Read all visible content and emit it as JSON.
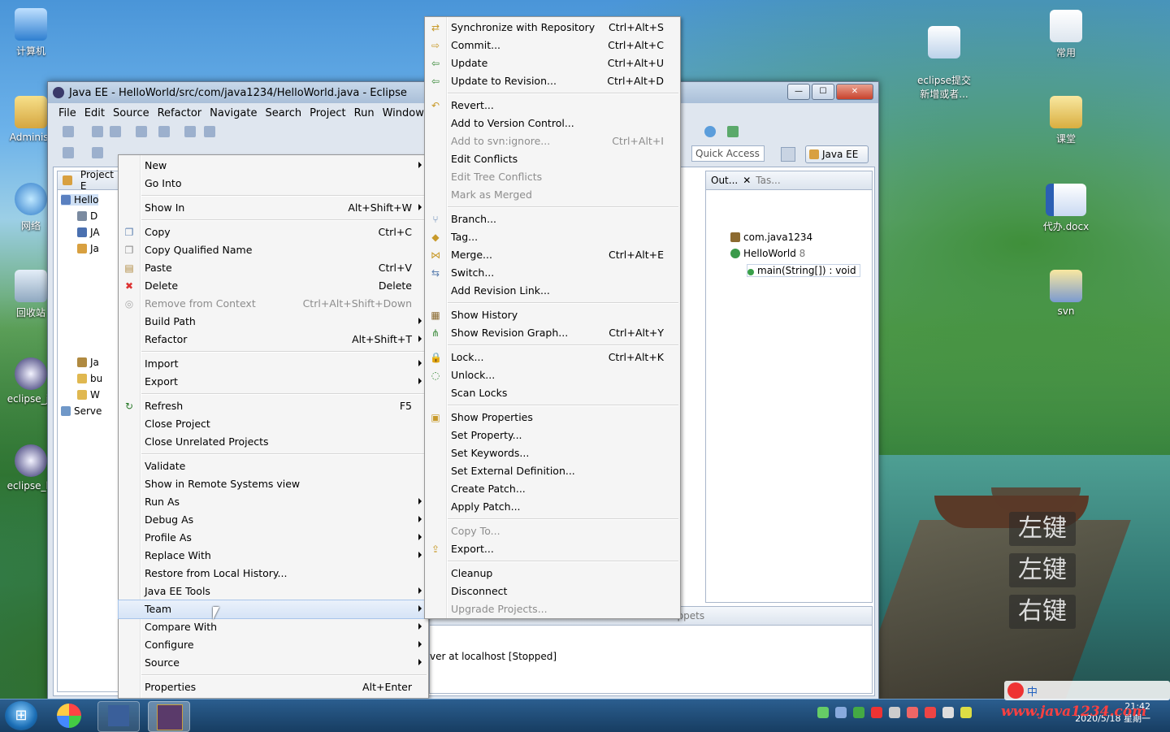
{
  "desktop": {
    "icons": [
      {
        "id": "computer",
        "label": "计算机"
      },
      {
        "id": "admin",
        "label": "Administ"
      },
      {
        "id": "network",
        "label": "网络"
      },
      {
        "id": "recycle",
        "label": "回收站"
      },
      {
        "id": "eclipse_ja",
        "label": "eclipse_ja"
      },
      {
        "id": "eclipse_lu",
        "label": "eclipse_lu"
      },
      {
        "id": "eclipse_submit",
        "label": "eclipse提交\n新增或者..."
      },
      {
        "id": "common",
        "label": "常用"
      },
      {
        "id": "course",
        "label": "课堂"
      },
      {
        "id": "todo",
        "label": "代办.docx"
      },
      {
        "id": "svn",
        "label": "svn"
      }
    ],
    "key_hints": [
      "左键",
      "左键",
      "右键"
    ]
  },
  "window": {
    "title": "Java EE - HelloWorld/src/com/java1234/HelloWorld.java - Eclipse",
    "menubar": [
      "File",
      "Edit",
      "Source",
      "Refactor",
      "Navigate",
      "Search",
      "Project",
      "Run",
      "Window"
    ],
    "quick_access": "Quick Access",
    "perspective": "Java EE"
  },
  "project_explorer": {
    "tab": "Project E",
    "rows": [
      "Hello",
      "D",
      "JA",
      "Ja",
      "Ja",
      "bu",
      "W",
      "Serve"
    ]
  },
  "outline": {
    "tab_outline": "Out...",
    "tab_tasks": "Tas...",
    "package": "com.java1234",
    "class_name": "HelloWorld",
    "class_rev": "8",
    "method": "main(String[]) : void"
  },
  "servers": {
    "tab_snippets": "Snippets",
    "status": "ver at localhost  [Stopped]"
  },
  "context_menu": [
    {
      "label": "New",
      "arrow": true
    },
    {
      "label": "Go Into"
    },
    {
      "sep": true
    },
    {
      "label": "Show In",
      "shortcut": "Alt+Shift+W",
      "arrow": true
    },
    {
      "sep": true
    },
    {
      "label": "Copy",
      "shortcut": "Ctrl+C",
      "icon": "copy-icon"
    },
    {
      "label": "Copy Qualified Name",
      "icon": "copy-qualified-icon"
    },
    {
      "label": "Paste",
      "shortcut": "Ctrl+V",
      "icon": "paste-icon"
    },
    {
      "label": "Delete",
      "shortcut": "Delete",
      "icon": "delete-icon"
    },
    {
      "label": "Remove from Context",
      "shortcut": "Ctrl+Alt+Shift+Down",
      "disabled": true,
      "icon": "remove-context-icon"
    },
    {
      "label": "Build Path",
      "arrow": true
    },
    {
      "label": "Refactor",
      "shortcut": "Alt+Shift+T",
      "arrow": true
    },
    {
      "sep": true
    },
    {
      "label": "Import",
      "arrow": true
    },
    {
      "label": "Export",
      "arrow": true
    },
    {
      "sep": true
    },
    {
      "label": "Refresh",
      "shortcut": "F5",
      "icon": "refresh-icon"
    },
    {
      "label": "Close Project"
    },
    {
      "label": "Close Unrelated Projects"
    },
    {
      "sep": true
    },
    {
      "label": "Validate"
    },
    {
      "label": "Show in Remote Systems view"
    },
    {
      "label": "Run As",
      "arrow": true
    },
    {
      "label": "Debug As",
      "arrow": true
    },
    {
      "label": "Profile As",
      "arrow": true
    },
    {
      "label": "Replace With",
      "arrow": true
    },
    {
      "label": "Restore from Local History..."
    },
    {
      "label": "Java EE Tools",
      "arrow": true
    },
    {
      "label": "Team",
      "arrow": true,
      "highlight": true
    },
    {
      "label": "Compare With",
      "arrow": true
    },
    {
      "label": "Configure",
      "arrow": true
    },
    {
      "label": "Source",
      "arrow": true
    },
    {
      "sep": true
    },
    {
      "label": "Properties",
      "shortcut": "Alt+Enter"
    }
  ],
  "team_menu": [
    {
      "label": "Synchronize with Repository",
      "shortcut": "Ctrl+Alt+S",
      "icon": "sync-icon"
    },
    {
      "label": "Commit...",
      "shortcut": "Ctrl+Alt+C",
      "icon": "commit-icon"
    },
    {
      "label": "Update",
      "shortcut": "Ctrl+Alt+U",
      "icon": "update-icon"
    },
    {
      "label": "Update to Revision...",
      "shortcut": "Ctrl+Alt+D",
      "icon": "update-revision-icon"
    },
    {
      "sep": true
    },
    {
      "label": "Revert...",
      "icon": "revert-icon"
    },
    {
      "label": "Add to Version Control..."
    },
    {
      "label": "Add to svn:ignore...",
      "shortcut": "Ctrl+Alt+I",
      "disabled": true
    },
    {
      "label": "Edit Conflicts"
    },
    {
      "label": "Edit Tree Conflicts",
      "disabled": true
    },
    {
      "label": "Mark as Merged",
      "disabled": true
    },
    {
      "sep": true
    },
    {
      "label": "Branch...",
      "icon": "branch-icon"
    },
    {
      "label": "Tag...",
      "icon": "tag-icon"
    },
    {
      "label": "Merge...",
      "shortcut": "Ctrl+Alt+E",
      "icon": "merge-icon"
    },
    {
      "label": "Switch...",
      "icon": "switch-icon"
    },
    {
      "label": "Add Revision Link..."
    },
    {
      "sep": true
    },
    {
      "label": "Show History",
      "icon": "history-icon"
    },
    {
      "label": "Show Revision Graph...",
      "shortcut": "Ctrl+Alt+Y",
      "icon": "graph-icon"
    },
    {
      "sep": true
    },
    {
      "label": "Lock...",
      "shortcut": "Ctrl+Alt+K",
      "icon": "lock-icon"
    },
    {
      "label": "Unlock...",
      "icon": "unlock-icon"
    },
    {
      "label": "Scan Locks"
    },
    {
      "sep": true
    },
    {
      "label": "Show Properties",
      "icon": "properties-icon"
    },
    {
      "label": "Set Property..."
    },
    {
      "label": "Set Keywords..."
    },
    {
      "label": "Set External Definition..."
    },
    {
      "label": "Create Patch..."
    },
    {
      "label": "Apply Patch..."
    },
    {
      "sep": true
    },
    {
      "label": "Copy To...",
      "disabled": true
    },
    {
      "label": "Export...",
      "icon": "export-icon"
    },
    {
      "sep": true
    },
    {
      "label": "Cleanup"
    },
    {
      "label": "Disconnect"
    },
    {
      "label": "Upgrade Projects...",
      "disabled": true
    }
  ],
  "taskbar": {
    "time": "21:42",
    "date": "2020/5/18 星期一",
    "watermark": "www.java1234.com",
    "ime": "中"
  }
}
